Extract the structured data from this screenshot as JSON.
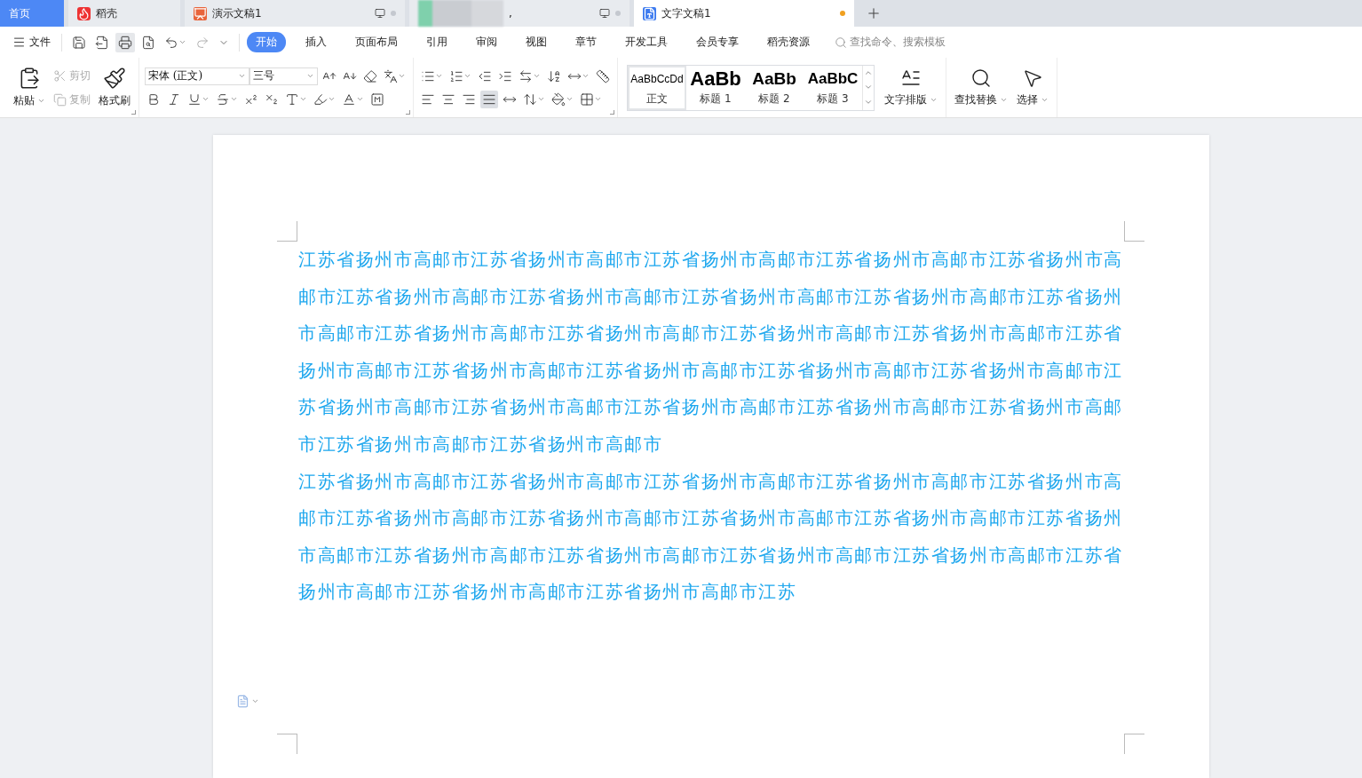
{
  "tabs": [
    {
      "label": "首页",
      "kind": "home",
      "selected": false
    },
    {
      "label": "稻壳",
      "kind": "docer",
      "selected": false
    },
    {
      "label": "演示文稿1",
      "kind": "slides",
      "selected": false,
      "unsaved": false
    },
    {
      "label": ",",
      "kind": "blurred",
      "selected": false,
      "unsaved": false
    },
    {
      "label": "文字文稿1",
      "kind": "writer",
      "selected": true,
      "unsaved": true
    }
  ],
  "menu": {
    "file": "文件",
    "tabs": [
      {
        "label": "开始",
        "selected": true
      },
      {
        "label": "插入",
        "selected": false
      },
      {
        "label": "页面布局",
        "selected": false
      },
      {
        "label": "引用",
        "selected": false
      },
      {
        "label": "审阅",
        "selected": false
      },
      {
        "label": "视图",
        "selected": false
      },
      {
        "label": "章节",
        "selected": false
      },
      {
        "label": "开发工具",
        "selected": false
      },
      {
        "label": "会员专享",
        "selected": false
      },
      {
        "label": "稻壳资源",
        "selected": false
      }
    ],
    "search": {
      "placeholder": "查找命令、搜索模板"
    }
  },
  "ribbon": {
    "clipboard": {
      "paste": "粘贴",
      "cut": {
        "label": "剪切",
        "disabled": true
      },
      "copy": {
        "label": "复制",
        "disabled": true
      },
      "format_painter": "格式刷"
    },
    "font": {
      "family": "宋体 (正文)",
      "size": "三号"
    },
    "paragraph": {
      "justify_selected": true
    },
    "styles": [
      {
        "preview": "AaBbCcDd",
        "label": "正文",
        "kind": "body",
        "selected": true
      },
      {
        "preview": "AaBb",
        "label": "标题 1",
        "kind": "h1",
        "selected": false
      },
      {
        "preview": "AaBb",
        "label": "标题 2",
        "kind": "h2",
        "selected": false
      },
      {
        "preview": "AaBbC",
        "label": "标题 3",
        "kind": "h3",
        "selected": false
      }
    ],
    "tools": {
      "layout": "文字排版",
      "find": "查找替换",
      "select": "选择"
    }
  },
  "document": {
    "paragraphs": [
      "江苏省扬州市高邮市江苏省扬州市高邮市江苏省扬州市高邮市江苏省扬州市高邮市江苏省扬州市高邮市江苏省扬州市高邮市江苏省扬州市高邮市江苏省扬州市高邮市江苏省扬州市高邮市江苏省扬州市高邮市江苏省扬州市高邮市江苏省扬州市高邮市江苏省扬州市高邮市江苏省扬州市高邮市江苏省扬州市高邮市江苏省扬州市高邮市江苏省扬州市高邮市江苏省扬州市高邮市江苏省扬州市高邮市江苏省扬州市高邮市江苏省扬州市高邮市江苏省扬州市高邮市江苏省扬州市高邮市江苏省扬州市高邮市江苏省扬州市高邮市江苏省扬州市高邮市",
      "江苏省扬州市高邮市江苏省扬州市高邮市江苏省扬州市高邮市江苏省扬州市高邮市江苏省扬州市高邮市江苏省扬州市高邮市江苏省扬州市高邮市江苏省扬州市高邮市江苏省扬州市高邮市江苏省扬州市高邮市江苏省扬州市高邮市江苏省扬州市高邮市江苏省扬州市高邮市江苏省扬州市高邮市江苏省扬州市高邮市江苏省扬州市高邮市江苏省扬州市高邮市江苏"
    ]
  }
}
